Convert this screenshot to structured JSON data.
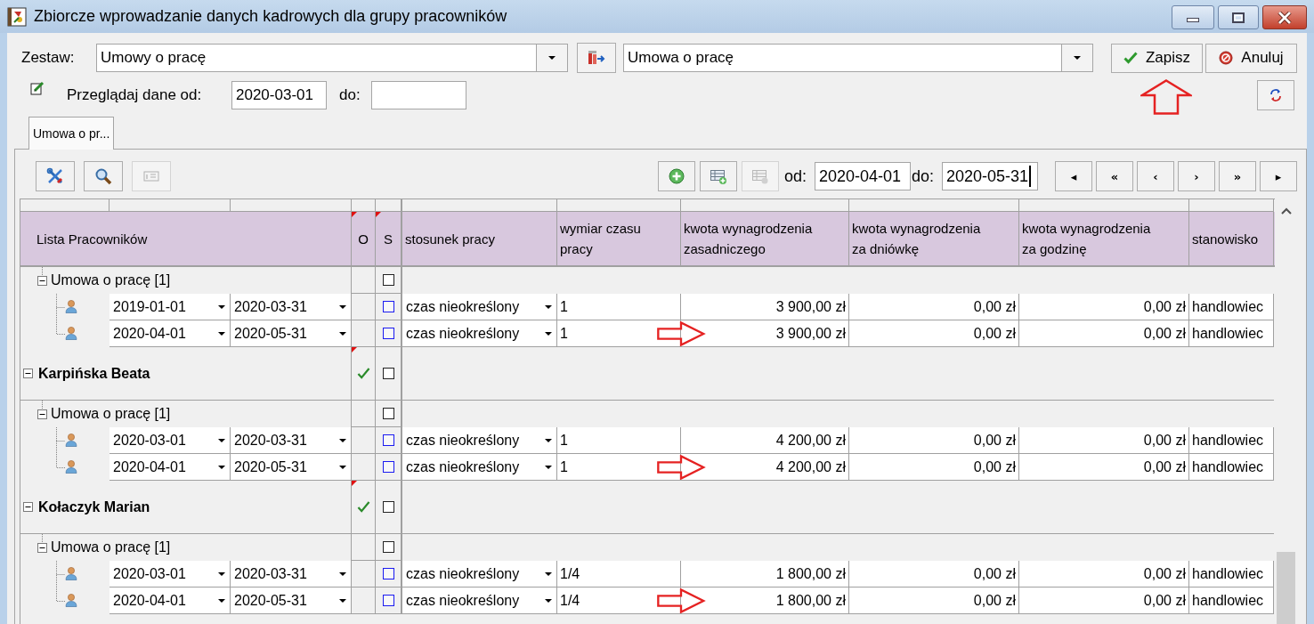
{
  "window": {
    "title": "Zbiorcze wprowadzanie danych kadrowych dla grupy pracowników"
  },
  "set_row": {
    "label": "Zestaw:",
    "set_value": "Umowy o pracę",
    "form_value": "Umowa o pracę"
  },
  "actions": [
    {
      "kind": "save",
      "label": "Zapisz",
      "annotated": true
    },
    {
      "kind": "cancel",
      "label": "Anuluj",
      "annotated": false
    }
  ],
  "filter": {
    "from_label": "Przeglądaj dane od:",
    "from": "2020-03-01",
    "to_label": "do:"
  },
  "tabs": [
    {
      "label": "Umowa o pr...",
      "selected": true
    }
  ],
  "grid_toolbar": {
    "left_buttons": [
      {
        "kind": "tools",
        "disabled": false
      },
      {
        "kind": "search",
        "disabled": false
      },
      {
        "kind": "card",
        "disabled": true
      }
    ],
    "right_buttons": [
      {
        "kind": "add",
        "disabled": false
      },
      {
        "kind": "add_row",
        "disabled": false
      },
      {
        "kind": "table",
        "disabled": true
      }
    ],
    "range": [
      {
        "label": "od:",
        "value": "2020-04-01",
        "focused": false
      },
      {
        "label": "do:",
        "value": "2020-05-31",
        "focused": true
      }
    ],
    "nav_buttons": [
      "◂",
      "«",
      "‹",
      "›",
      "»",
      "▸"
    ]
  },
  "table": {
    "columns": [
      {
        "label": "Lista Pracowników",
        "kind": "tree",
        "flagged": false
      },
      {
        "label": "O",
        "kind": "flag",
        "flagged": true
      },
      {
        "label": "S",
        "kind": "check",
        "flagged": true
      },
      {
        "label": "stosunek pracy",
        "kind": "choice",
        "flagged": false
      },
      {
        "label": "wymiar czasu pracy",
        "kind": "text",
        "flagged": false
      },
      {
        "label": "kwota wynagrodzenia zasadniczego",
        "kind": "amount",
        "flagged": false
      },
      {
        "label": "kwota wynagrodzenia za dniówkę",
        "kind": "amount",
        "flagged": false
      },
      {
        "label": "kwota wynagrodzenia za godzinę",
        "kind": "amount",
        "flagged": false
      },
      {
        "label": "stanowisko",
        "kind": "text",
        "flagged": false
      }
    ],
    "rows": [
      {
        "kind": "employee",
        "children": [
          {
            "kind": "group",
            "label": "Umowa o pracę [1]",
            "expanded": true,
            "s_checked": false,
            "children": [
              {
                "kind": "contract",
                "dates": [
                  "2019-01-01",
                  "2020-03-31"
                ],
                "s_checked": false,
                "cells": [
                  "czas nieokreślony",
                  "1",
                  "3 900,00 zł",
                  "0,00 zł",
                  "0,00 zł",
                  "handlowiec"
                ],
                "annotated": false
              },
              {
                "kind": "contract",
                "dates": [
                  "2020-04-01",
                  "2020-05-31"
                ],
                "s_checked": false,
                "cells": [
                  "czas nieokreślony",
                  "1",
                  "3 900,00 zł",
                  "0,00 zł",
                  "0,00 zł",
                  "handlowiec"
                ],
                "annotated": true
              }
            ]
          }
        ]
      },
      {
        "kind": "employee",
        "name": "Karpińska Beata",
        "expanded": true,
        "flagged": true,
        "o_checked": true,
        "s_checked": false,
        "children": [
          {
            "kind": "group",
            "label": "Umowa o pracę [1]",
            "expanded": true,
            "s_checked": false,
            "children": [
              {
                "kind": "contract",
                "dates": [
                  "2020-03-01",
                  "2020-03-31"
                ],
                "s_checked": false,
                "cells": [
                  "czas nieokreślony",
                  "1",
                  "4 200,00 zł",
                  "0,00 zł",
                  "0,00 zł",
                  "handlowiec"
                ],
                "annotated": false
              },
              {
                "kind": "contract",
                "dates": [
                  "2020-04-01",
                  "2020-05-31"
                ],
                "s_checked": false,
                "cells": [
                  "czas nieokreślony",
                  "1",
                  "4 200,00 zł",
                  "0,00 zł",
                  "0,00 zł",
                  "handlowiec"
                ],
                "annotated": true
              }
            ]
          }
        ]
      },
      {
        "kind": "employee",
        "name": "Kołaczyk Marian",
        "expanded": true,
        "flagged": true,
        "o_checked": true,
        "s_checked": false,
        "children": [
          {
            "kind": "group",
            "label": "Umowa o pracę [1]",
            "expanded": true,
            "s_checked": false,
            "children": [
              {
                "kind": "contract",
                "dates": [
                  "2020-03-01",
                  "2020-03-31"
                ],
                "s_checked": false,
                "cells": [
                  "czas nieokreślony",
                  "1/4",
                  "1 800,00 zł",
                  "0,00 zł",
                  "0,00 zł",
                  "handlowiec"
                ],
                "annotated": false
              },
              {
                "kind": "contract",
                "dates": [
                  "2020-04-01",
                  "2020-05-31"
                ],
                "s_checked": false,
                "cells": [
                  "czas nieokreślony",
                  "1/4",
                  "1 800,00 zł",
                  "0,00 zł",
                  "0,00 zł",
                  "handlowiec"
                ],
                "annotated": true
              }
            ]
          }
        ]
      }
    ]
  }
}
